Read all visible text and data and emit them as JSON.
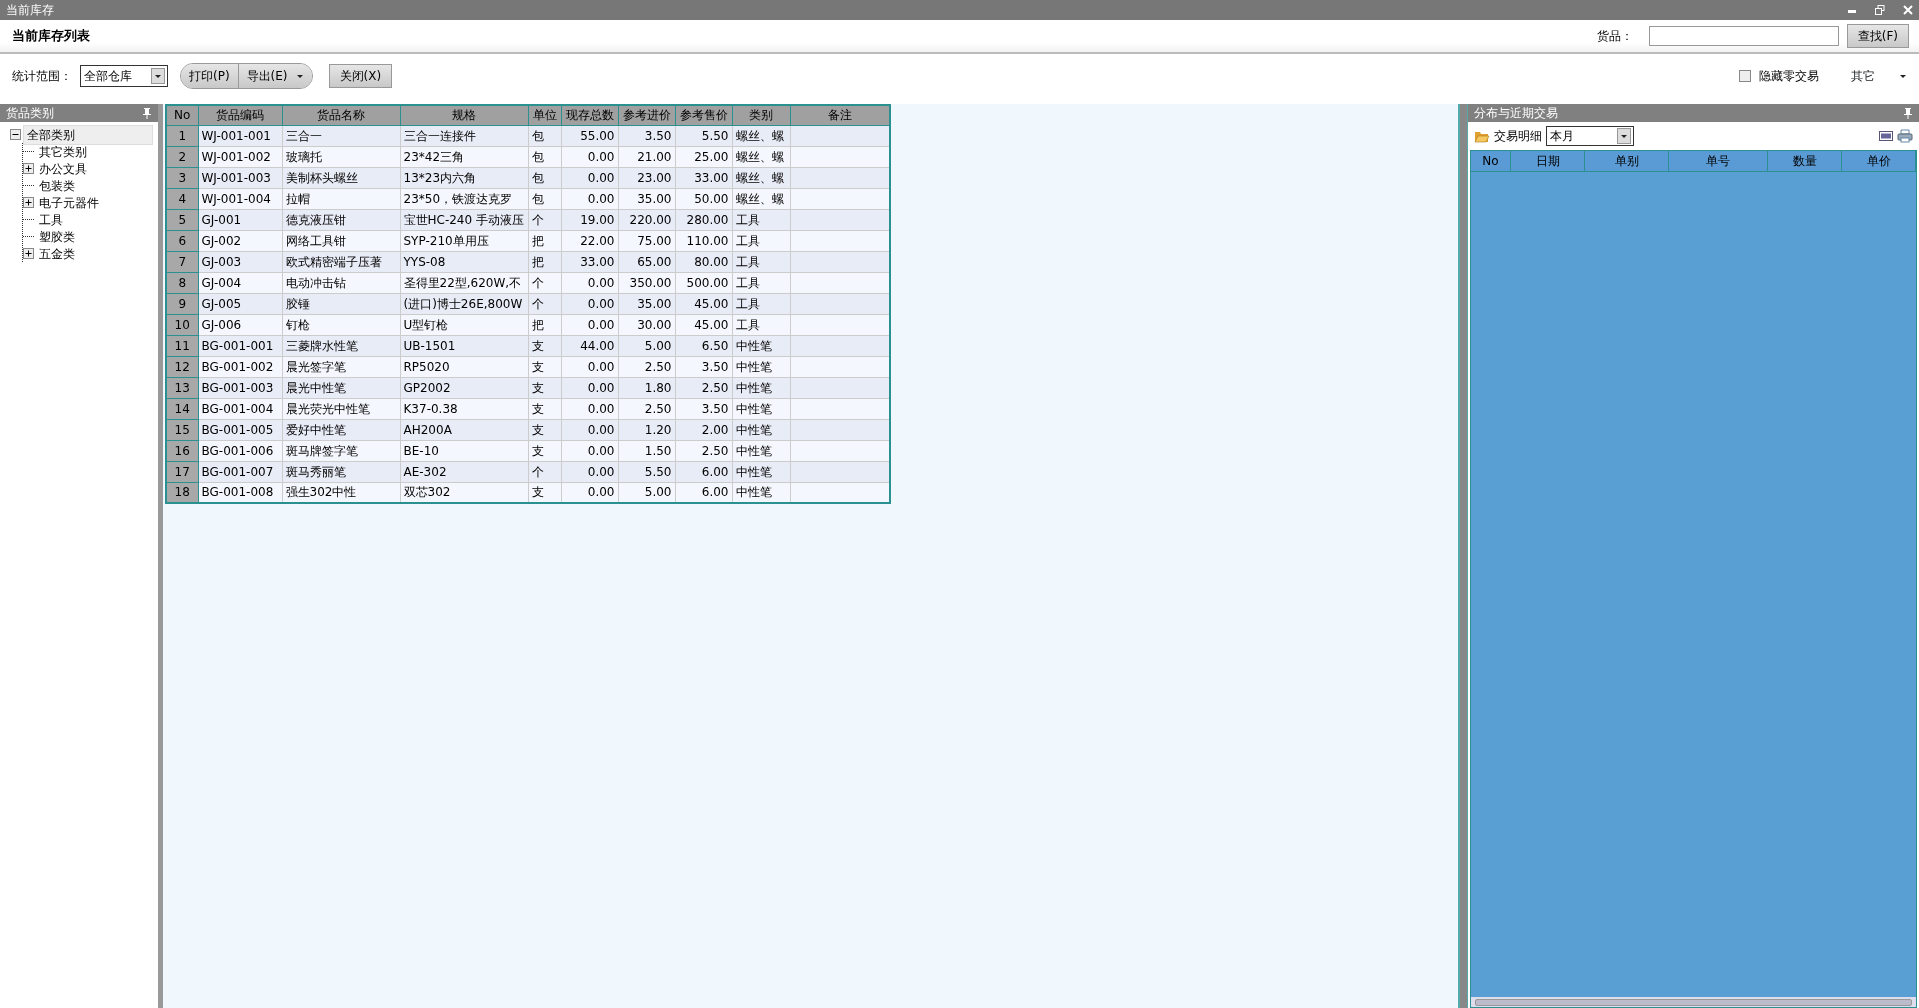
{
  "window": {
    "title": "当前库存"
  },
  "header": {
    "title": "当前库存列表",
    "search_label": "货品：",
    "search_button": "查找(F)"
  },
  "toolbar": {
    "range_label": "统计范围：",
    "range_select": "全部仓库",
    "print_button": "打印(P)",
    "export_button": "导出(E)",
    "close_button": "关闭(X)",
    "hide_zero": {
      "label": "隐藏零交易",
      "checked": false
    },
    "other_menu": "其它"
  },
  "category_panel": {
    "title": "货品类别",
    "tree": [
      {
        "label": "全部类别",
        "expanded": true,
        "selected": true,
        "children": [
          {
            "label": "其它类别",
            "selected": false
          },
          {
            "label": "办公文具",
            "expanded": false,
            "selected": false
          },
          {
            "label": "包装类",
            "selected": false
          },
          {
            "label": "电子元器件",
            "expanded": false,
            "selected": false
          },
          {
            "label": "工具",
            "selected": false
          },
          {
            "label": "塑胶类",
            "selected": false
          },
          {
            "label": "五金类",
            "expanded": false,
            "selected": false
          }
        ]
      }
    ]
  },
  "inventory_table": {
    "columns": [
      "No",
      "货品编码",
      "货品名称",
      "规格",
      "单位",
      "现存总数",
      "参考进价",
      "参考售价",
      "类别",
      "备注"
    ],
    "rows": [
      [
        "1",
        "WJ-001-001",
        "三合一",
        "三合一连接件",
        "包",
        "55.00",
        "3.50",
        "5.50",
        "螺丝、螺"
      ],
      [
        "2",
        "WJ-001-002",
        "玻璃托",
        "23*42三角",
        "包",
        "0.00",
        "21.00",
        "25.00",
        "螺丝、螺"
      ],
      [
        "3",
        "WJ-001-003",
        "美制杯头螺丝",
        "13*23内六角",
        "包",
        "0.00",
        "23.00",
        "33.00",
        "螺丝、螺"
      ],
      [
        "4",
        "WJ-001-004",
        "拉帽",
        "23*50，铁渡达克罗",
        "包",
        "0.00",
        "35.00",
        "50.00",
        "螺丝、螺"
      ],
      [
        "5",
        "GJ-001",
        "德克液压钳",
        "宝世HC-240 手动液压",
        "个",
        "19.00",
        "220.00",
        "280.00",
        "工具"
      ],
      [
        "6",
        "GJ-002",
        "网络工具钳",
        "SYP-210单用压",
        "把",
        "22.00",
        "75.00",
        "110.00",
        "工具"
      ],
      [
        "7",
        "GJ-003",
        "欧式精密端子压著",
        "YYS-08",
        "把",
        "33.00",
        "65.00",
        "80.00",
        "工具"
      ],
      [
        "8",
        "GJ-004",
        "电动冲击钻",
        "圣得里22型,620W,不",
        "个",
        "0.00",
        "350.00",
        "500.00",
        "工具"
      ],
      [
        "9",
        "GJ-005",
        "胶锤",
        "(进口)博士26E,800W",
        "个",
        "0.00",
        "35.00",
        "45.00",
        "工具"
      ],
      [
        "10",
        "GJ-006",
        "钉枪",
        "U型钉枪",
        "把",
        "0.00",
        "30.00",
        "45.00",
        "工具"
      ],
      [
        "11",
        "BG-001-001",
        "三菱牌水性笔",
        "UB-1501",
        "支",
        "44.00",
        "5.00",
        "6.50",
        "中性笔"
      ],
      [
        "12",
        "BG-001-002",
        "晨光签字笔",
        "RP5020",
        "支",
        "0.00",
        "2.50",
        "3.50",
        "中性笔"
      ],
      [
        "13",
        "BG-001-003",
        "晨光中性笔",
        "GP2002",
        "支",
        "0.00",
        "1.80",
        "2.50",
        "中性笔"
      ],
      [
        "14",
        "BG-001-004",
        "晨光荧光中性笔",
        "K37-0.38",
        "支",
        "0.00",
        "2.50",
        "3.50",
        "中性笔"
      ],
      [
        "15",
        "BG-001-005",
        "爱好中性笔",
        "AH200A",
        "支",
        "0.00",
        "1.20",
        "2.00",
        "中性笔"
      ],
      [
        "16",
        "BG-001-006",
        "斑马牌签字笔",
        "BE-10",
        "支",
        "0.00",
        "1.50",
        "2.50",
        "中性笔"
      ],
      [
        "17",
        "BG-001-007",
        "斑马秀丽笔",
        "AE-302",
        "个",
        "0.00",
        "5.50",
        "6.00",
        "中性笔"
      ],
      [
        "18",
        "BG-001-008",
        "强生302中性",
        "双芯302",
        "支",
        "0.00",
        "5.00",
        "6.00",
        "中性笔"
      ]
    ]
  },
  "transactions_panel": {
    "title": "分布与近期交易",
    "detail_label": "交易明细",
    "period_select": "本月",
    "columns": [
      "No",
      "日期",
      "单别",
      "单号",
      "数量",
      "单价"
    ]
  }
}
